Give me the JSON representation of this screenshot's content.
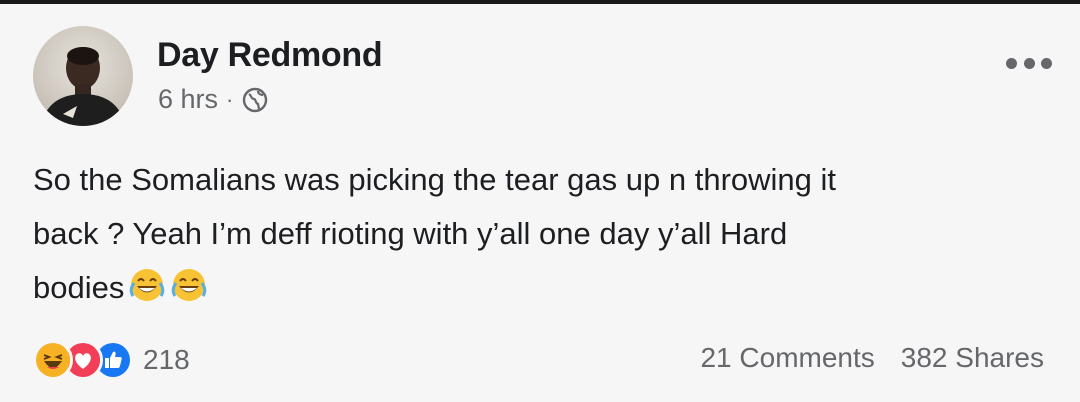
{
  "post": {
    "author_name": "Day Redmond",
    "timestamp": "6 hrs",
    "separator": "·",
    "privacy_icon": "globe-icon",
    "more_icon": "more-options-icon",
    "text_lines": [
      "So the Somalians was picking the tear gas up n throwing it",
      "back ? Yeah I’m deff rioting with y’all one day y’all Hard",
      "bodies"
    ],
    "inline_emojis": [
      "tears-of-joy-icon",
      "tears-of-joy-icon"
    ],
    "reactions": {
      "icons": [
        "haha-reaction-icon",
        "love-reaction-icon",
        "like-reaction-icon"
      ],
      "count": "218"
    },
    "comments_label": "21 Comments",
    "shares_label": "382 Shares"
  },
  "colors": {
    "background": "#f6f6f6",
    "primary_text": "#1c1e21",
    "secondary_text": "#65676b",
    "like_blue": "#1877f2",
    "love_red": "#f33e58",
    "haha_yellow": "#f7b125"
  }
}
